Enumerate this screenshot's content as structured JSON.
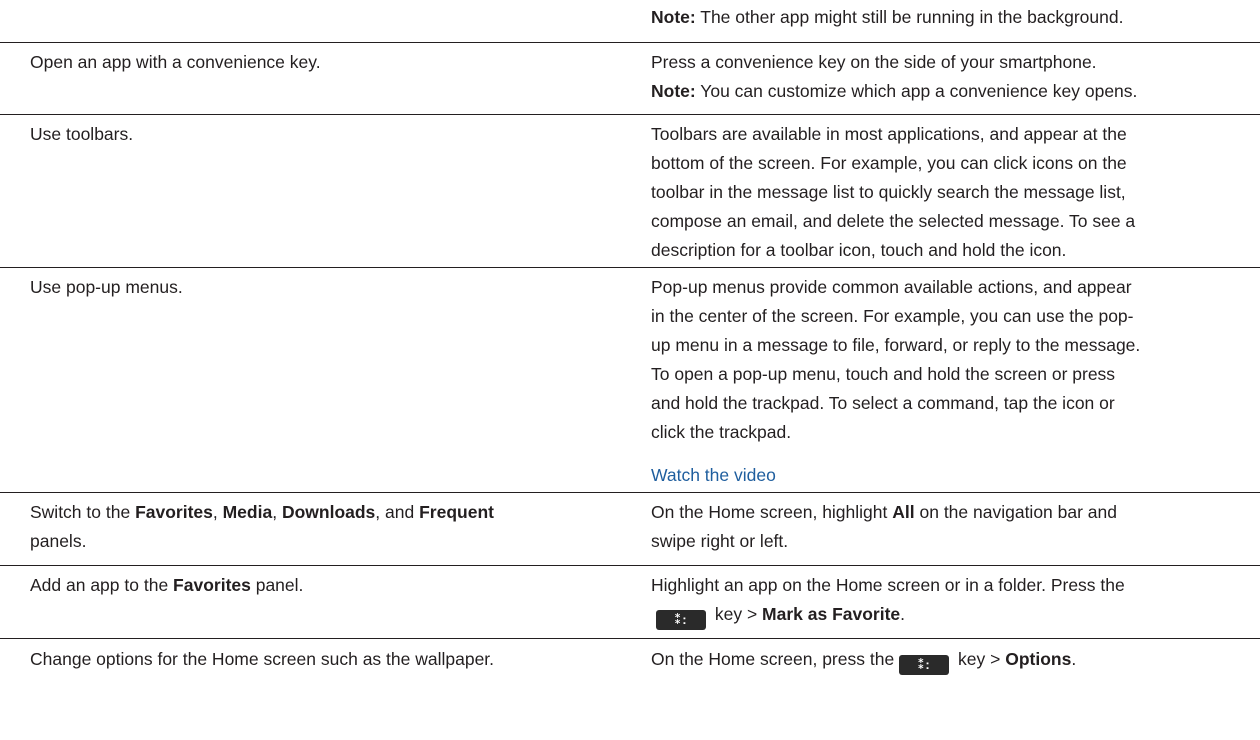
{
  "rows": [
    {
      "right": [
        {
          "bold": "Note:",
          "text": " The other app might still be running in the background."
        }
      ]
    },
    {
      "left": "Open an app with a convenience key.",
      "right": [
        {
          "text": "Press a convenience key on the side of your smartphone."
        },
        {
          "bold": "Note:",
          "text": " You can customize which app a convenience key opens."
        }
      ]
    },
    {
      "left": "Use toolbars.",
      "right_lines": [
        "Toolbars are available in most applications, and appear at the",
        "bottom of the screen. For example, you can click icons on the",
        "toolbar in the message list to quickly search the message list,",
        "compose an email, and delete the selected message. To see a",
        "description for a toolbar icon, touch and hold the icon."
      ]
    },
    {
      "left": "Use pop-up menus.",
      "right_lines": [
        "Pop-up menus provide common available actions, and appear",
        "in the center of the screen. For example, you can use the pop-",
        "up menu in a message to file, forward, or reply to the message.",
        "To open a pop-up menu, touch and hold the screen or press",
        "and hold the trackpad. To select a command, tap the icon or",
        "click the trackpad."
      ],
      "link": "Watch the video"
    },
    {
      "left": {
        "t1": "Switch to the ",
        "b1": "Favorites",
        "t2": ", ",
        "b2": "Media",
        "t3": ", ",
        "b3": "Downloads",
        "t4": ", and ",
        "b4": "Frequent",
        "t5": "panels."
      },
      "right": {
        "t1": "On the Home screen, highlight ",
        "b1": "All",
        "t2": " on the navigation bar and",
        "t3": "swipe right or left."
      }
    },
    {
      "left": {
        "t1": "Add an app to the ",
        "b1": "Favorites",
        "t2": " panel."
      },
      "right": {
        "t1": "Highlight an app on the Home screen or in a folder. Press the",
        "t2": " key > ",
        "b1": "Mark as Favorite",
        "t3": "."
      }
    },
    {
      "left": "Change options for the Home screen such as the wallpaper.",
      "right": {
        "t1": "On the Home screen, press the",
        "t2": " key > ",
        "b1": "Options",
        "t3": "."
      }
    }
  ],
  "key_glyph": "⁑:",
  "key_icon": "blackberry-menu-key-icon"
}
